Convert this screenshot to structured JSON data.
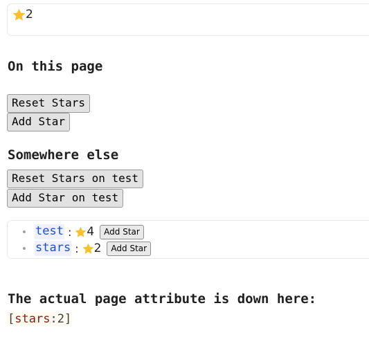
{
  "star_panel": {
    "icon": "star-icon",
    "count": "2"
  },
  "sections": {
    "on_this_page": {
      "heading": "On this page",
      "buttons": [
        {
          "name": "reset-stars-button",
          "label": "Reset Stars"
        },
        {
          "name": "add-star-button",
          "label": "Add Star"
        }
      ]
    },
    "somewhere_else": {
      "heading": "Somewhere else",
      "buttons": [
        {
          "name": "reset-stars-on-test-button",
          "label": "Reset Stars on test"
        },
        {
          "name": "add-star-on-test-button",
          "label": "Add Star on test"
        }
      ]
    }
  },
  "attributes_list": {
    "items": [
      {
        "key": "test",
        "separator": ":",
        "icon": "star-icon",
        "count": "4",
        "button_label": "Add Star"
      },
      {
        "key": "stars",
        "separator": ":",
        "icon": "star-icon",
        "count": "2",
        "button_label": "Add Star"
      }
    ]
  },
  "bottom": {
    "heading": "The actual page attribute is down here:",
    "attribute": {
      "open_bracket": "[",
      "key": "stars",
      "separator": ":",
      "value": "2",
      "close_bracket": "]"
    }
  },
  "colors": {
    "star": "#FBC02D",
    "code_key": "#1a4fd6",
    "code_key_bg": "#eef0fb",
    "attribute_key": "#8b1a1a",
    "attribute_bg": "#fdfbef",
    "panel_border": "#e8e8e8",
    "button_bg": "#e2e2e2"
  }
}
